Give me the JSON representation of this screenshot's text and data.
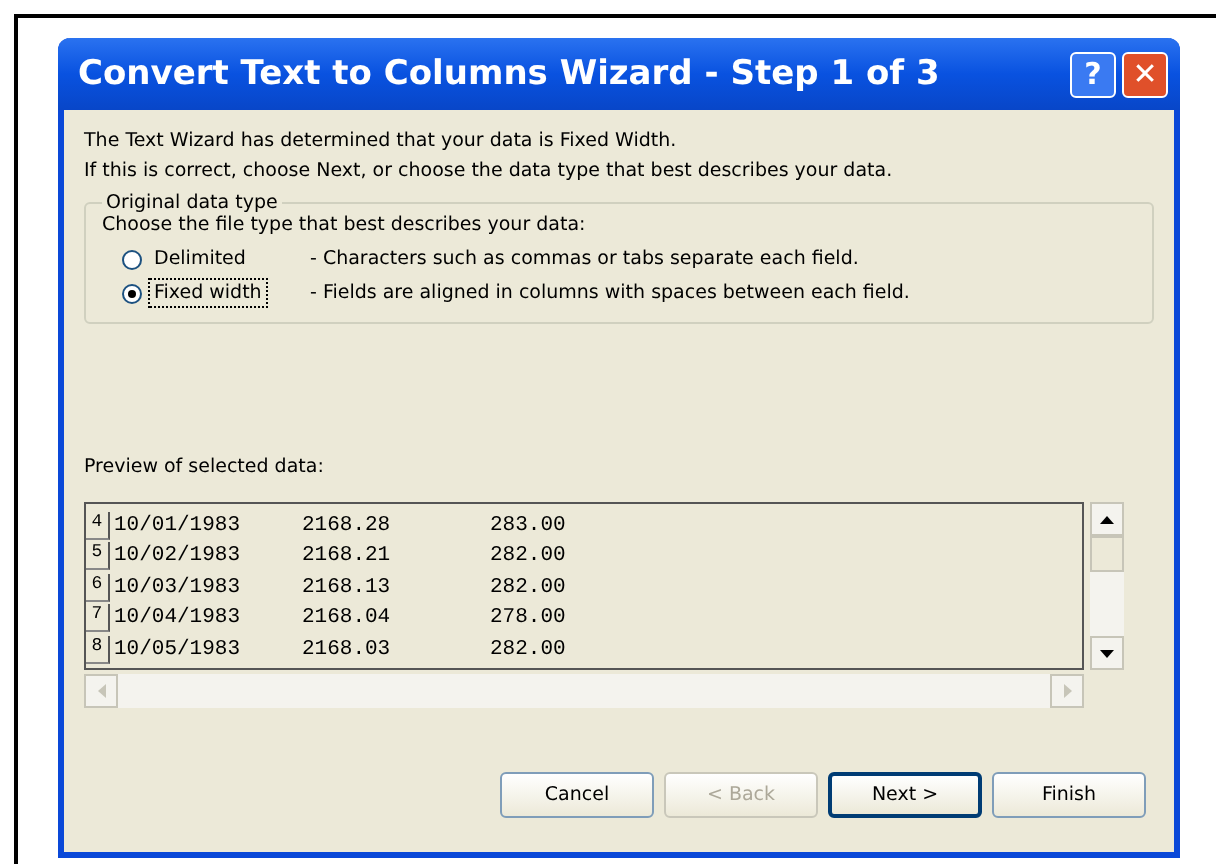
{
  "window": {
    "title": "Convert Text to Columns Wizard - Step 1 of 3",
    "title_buttons": [
      "?",
      "✕"
    ]
  },
  "intro": [
    "The Text Wizard has determined that your data is Fixed Width.",
    "If this is correct, choose Next, or choose the data type that best describes your data."
  ],
  "data_type_group": {
    "legend": "Original data type",
    "prompt": "Choose the file type that best describes your data:",
    "options": [
      {
        "label": "Delimited",
        "description": "- Characters such as commas or tabs separate each field.",
        "selected": false
      },
      {
        "label": "Fixed width",
        "description": "- Fields are aligned in columns with spaces between each field.",
        "selected": true
      }
    ]
  },
  "preview": {
    "label": "Preview of selected data:",
    "rows": [
      {
        "number": "4",
        "cells": [
          "10/01/1983",
          "2168.28",
          "283.00"
        ]
      },
      {
        "number": "5",
        "cells": [
          "10/02/1983",
          "2168.21",
          "282.00"
        ]
      },
      {
        "number": "6",
        "cells": [
          "10/03/1983",
          "2168.13",
          "282.00"
        ]
      },
      {
        "number": "7",
        "cells": [
          "10/04/1983",
          "2168.04",
          "278.00"
        ]
      },
      {
        "number": "8",
        "cells": [
          "10/05/1983",
          "2168.03",
          "282.00"
        ]
      }
    ]
  },
  "buttons": [
    {
      "label": "Cancel",
      "disabled": false,
      "default": false
    },
    {
      "label": "< Back",
      "disabled": true,
      "default": false
    },
    {
      "label": "Next >",
      "disabled": false,
      "default": true
    },
    {
      "label": "Finish",
      "disabled": false,
      "default": false
    }
  ]
}
